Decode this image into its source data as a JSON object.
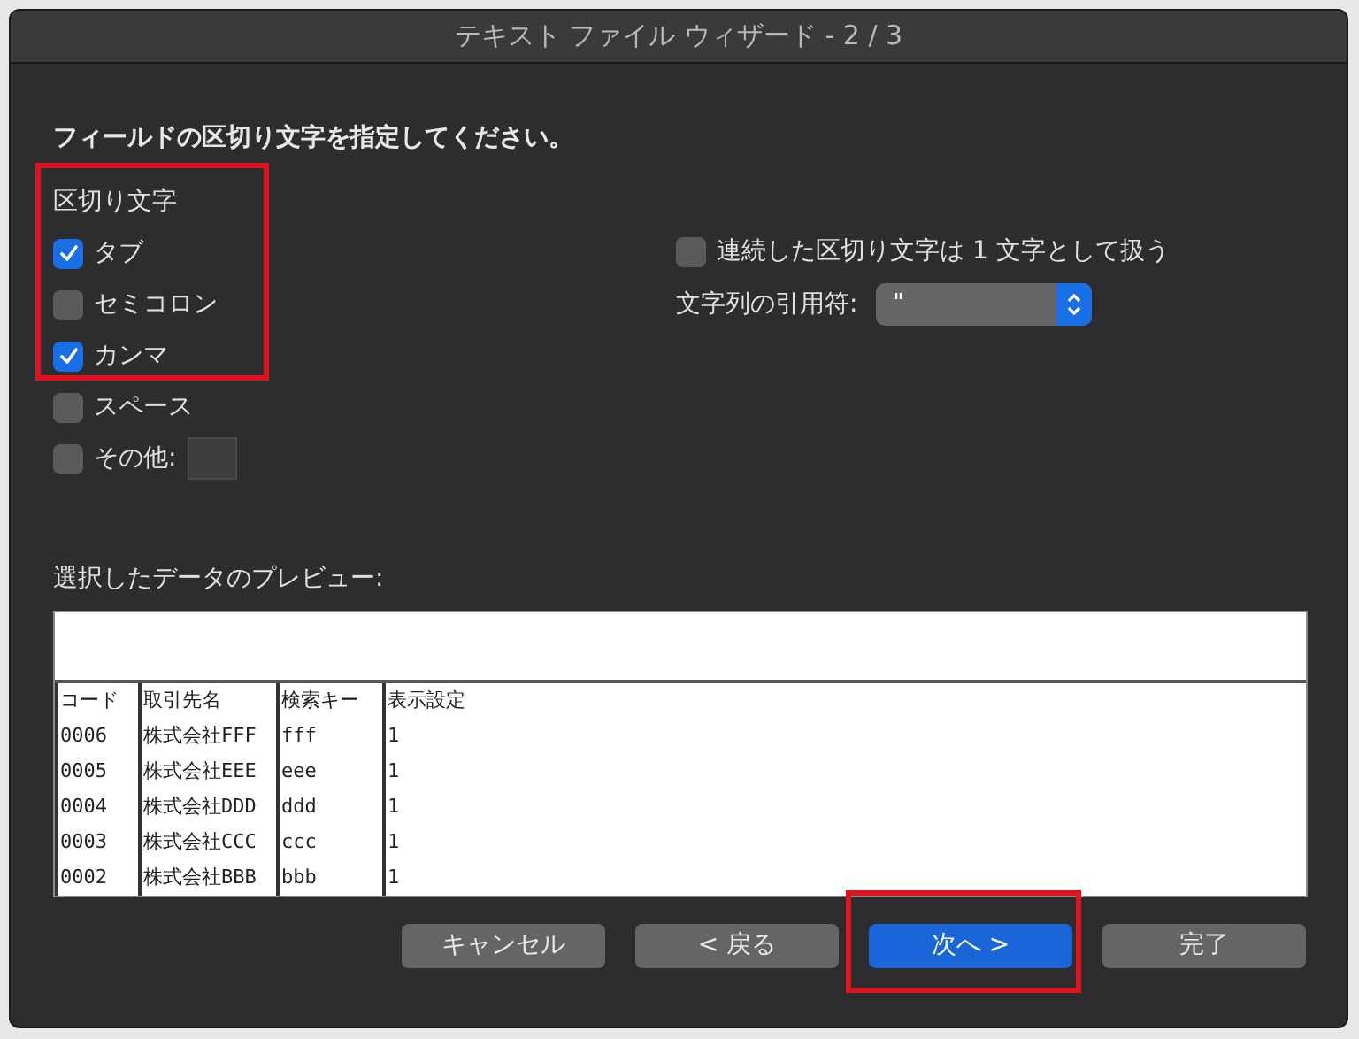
{
  "window": {
    "title": "テキスト ファイル ウィザード - 2 / 3"
  },
  "instruction": "フィールドの区切り文字を指定してください。",
  "delimiters": {
    "label": "区切り文字",
    "highlighted": true,
    "options": [
      {
        "kind": "checkbox",
        "label": "タブ",
        "checked": true
      },
      {
        "kind": "checkbox",
        "label": "セミコロン",
        "checked": false
      },
      {
        "kind": "checkbox",
        "label": "カンマ",
        "checked": true
      },
      {
        "kind": "checkbox",
        "label": "スペース",
        "checked": false
      },
      {
        "kind": "checkbox_with_field",
        "label": "その他:",
        "checked": false
      }
    ]
  },
  "consecutive": {
    "label": "連続した区切り文字は 1 文字として扱う",
    "checked": false
  },
  "text_qualifier": {
    "label": "文字列の引用符:",
    "value": "\""
  },
  "preview": {
    "label": "選択したデータのプレビュー:",
    "columns": [
      "コード",
      "取引先名",
      "検索キー",
      "表示設定"
    ],
    "rows": [
      [
        "0006",
        "株式会社FFF",
        "fff",
        "1"
      ],
      [
        "0005",
        "株式会社EEE",
        "eee",
        "1"
      ],
      [
        "0004",
        "株式会社DDD",
        "ddd",
        "1"
      ],
      [
        "0003",
        "株式会社CCC",
        "ccc",
        "1"
      ],
      [
        "0002",
        "株式会社BBB",
        "bbb",
        "1"
      ]
    ]
  },
  "buttons": [
    {
      "label": "キャンセル",
      "primary": false,
      "highlighted": false
    },
    {
      "label": "< 戻る",
      "primary": false,
      "highlighted": false
    },
    {
      "label": "次へ >",
      "primary": true,
      "highlighted": true
    },
    {
      "label": "完了",
      "primary": false,
      "highlighted": false
    }
  ]
}
